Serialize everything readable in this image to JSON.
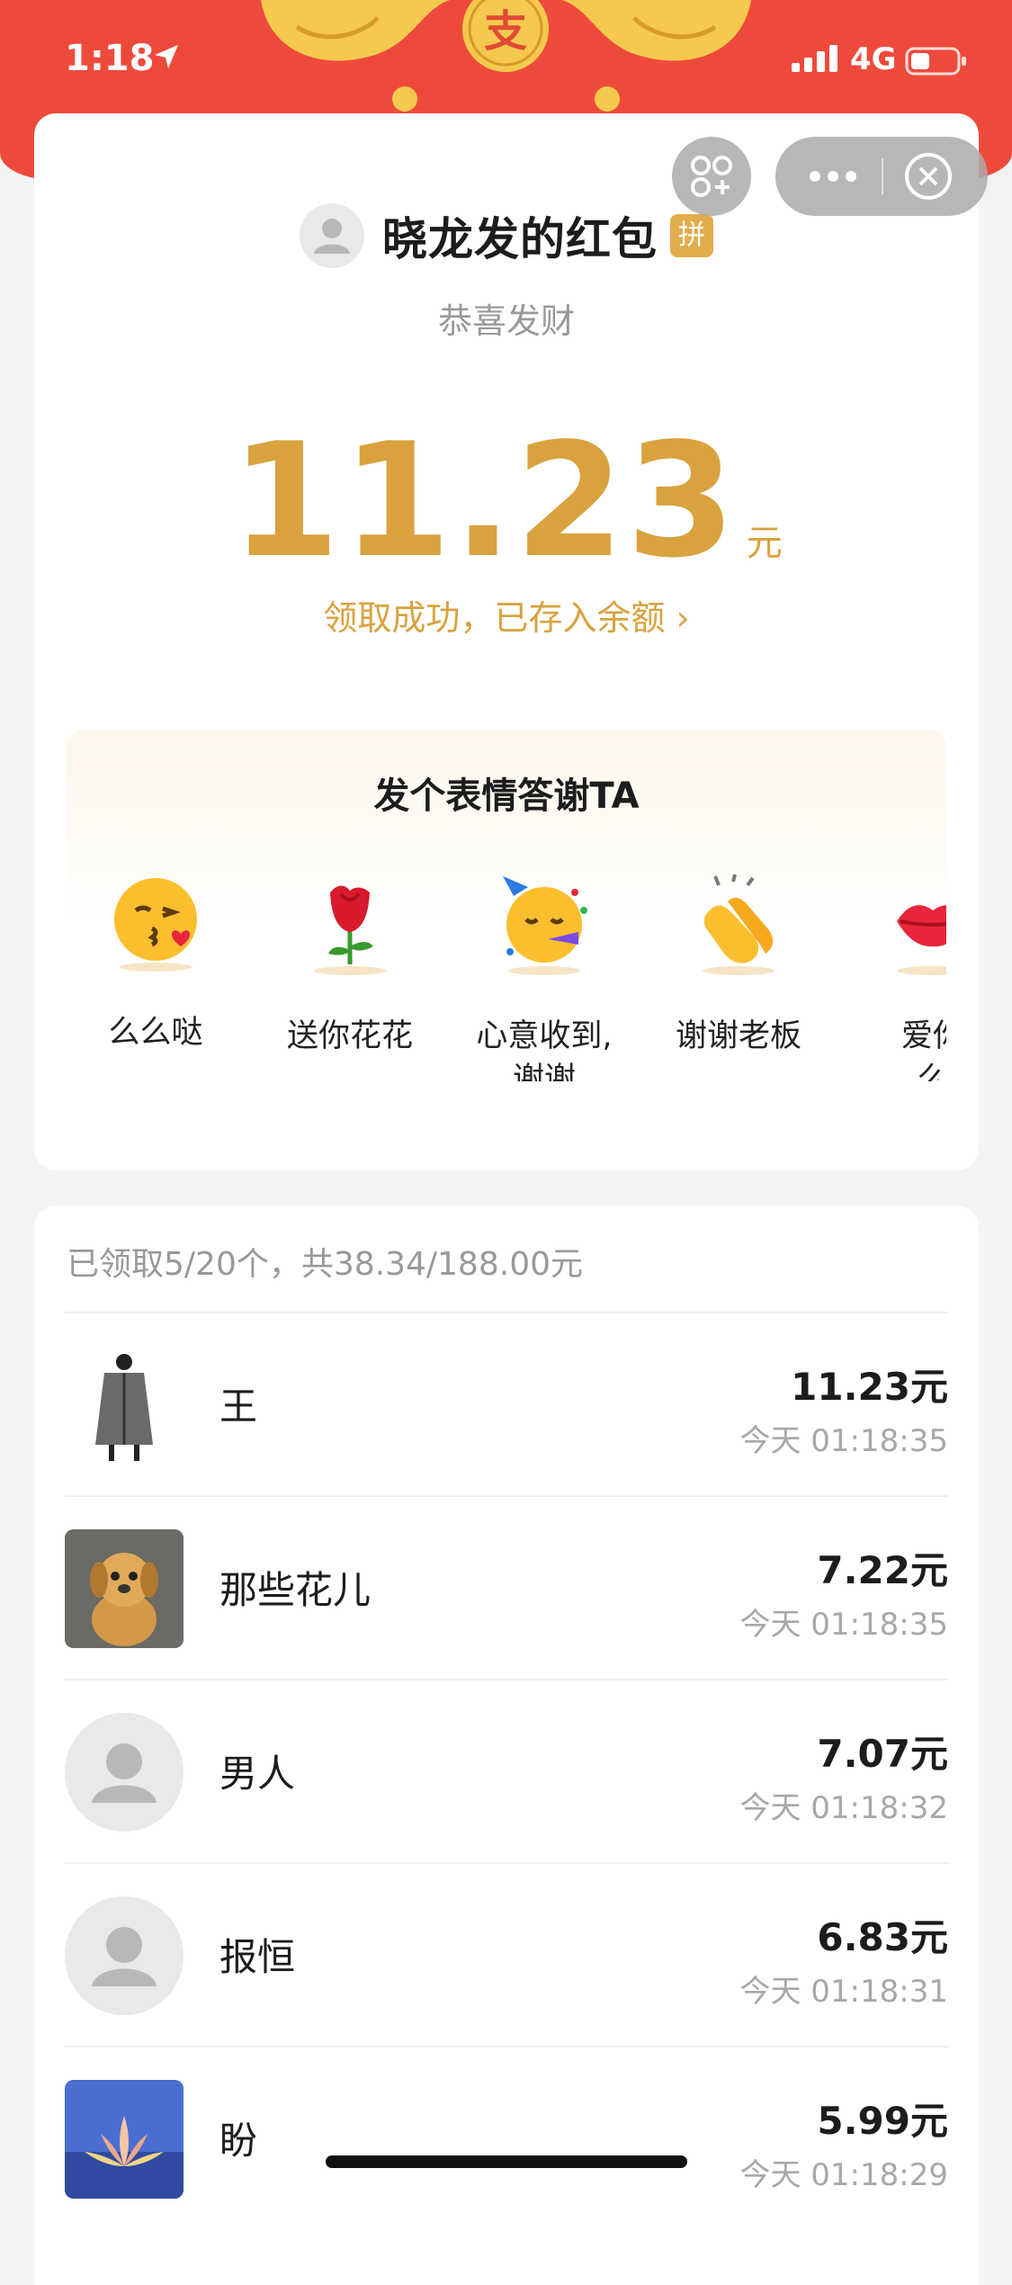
{
  "status_bar": {
    "time": "1:18",
    "network": "4G"
  },
  "envelope": {
    "logo_char": "支",
    "sender_title": "晓龙发的红包",
    "badge": "拼",
    "blessing": "恭喜发财",
    "amount": "11.23",
    "unit": "元",
    "stored_link": "领取成功，已存入余额 ›"
  },
  "thanks": {
    "title": "发个表情答谢TA",
    "items": [
      {
        "icon": "kiss-face-icon",
        "label": "么么哒"
      },
      {
        "icon": "rose-icon",
        "label": "送你花花"
      },
      {
        "icon": "party-face-icon",
        "label_line1": "心意收到,",
        "label_line2": "谢谢"
      },
      {
        "icon": "clapping-hands-icon",
        "label": "谢谢老板"
      },
      {
        "icon": "lips-icon",
        "label_line1": "爱你",
        "label_line2": "么"
      }
    ]
  },
  "claims": {
    "summary": "已领取5/20个，共38.34/188.00元",
    "rows": [
      {
        "name": "王",
        "amount": "11.23元",
        "time": "今天 01:18:35",
        "avatar": "coat-photo"
      },
      {
        "name": "那些花儿",
        "amount": "7.22元",
        "time": "今天 01:18:35",
        "avatar": "dog-photo"
      },
      {
        "name": "男人",
        "amount": "7.07元",
        "time": "今天 01:18:32",
        "avatar": "default-avatar"
      },
      {
        "name": "报恒",
        "amount": "6.83元",
        "time": "今天 01:18:31",
        "avatar": "default-avatar"
      },
      {
        "name": "盼",
        "amount": "5.99元",
        "time": "今天 01:18:29",
        "avatar": "lotus-photo"
      }
    ]
  },
  "colors": {
    "red": "#ee4a3b",
    "gold": "#d9a23f",
    "badge": "#e2ad4c"
  }
}
